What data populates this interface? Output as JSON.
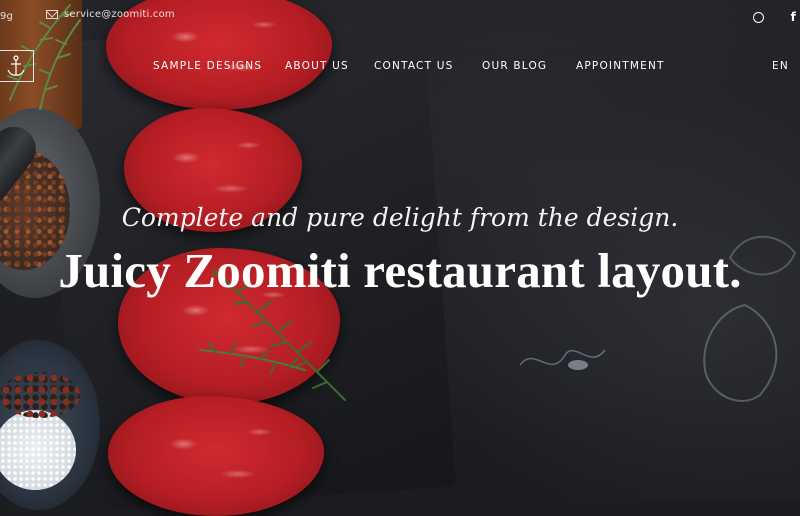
{
  "topbar": {
    "phone_fragment": "9g",
    "email": "service@zoomiti.com",
    "social": [
      "dribbble-icon",
      "facebook-icon"
    ],
    "facebook_glyph": "f"
  },
  "nav": {
    "items": [
      "SAMPLE DESIGNS",
      "ABOUT US",
      "CONTACT US",
      "OUR BLOG",
      "APPOINTMENT"
    ],
    "language": "EN"
  },
  "hero": {
    "tagline": "Complete and pure delight from the design.",
    "headline": "Juicy Zoomiti restaurant layout."
  },
  "colors": {
    "background": "#1c1d21",
    "meat": "#c0222a",
    "text": "#ffffff"
  }
}
